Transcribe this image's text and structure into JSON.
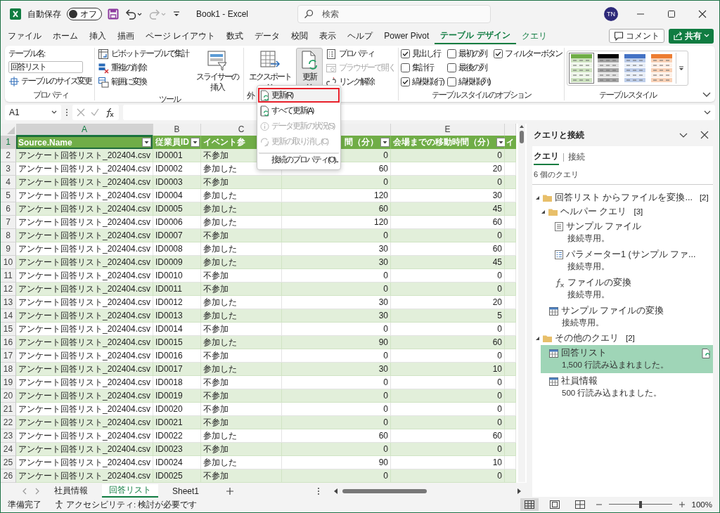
{
  "window": {
    "title": "Book1 - Excel",
    "autosave": {
      "label": "自動保存",
      "state_text": "オフ",
      "on": false
    },
    "quick_access": [
      {
        "kind": "save",
        "disabled": false
      },
      {
        "kind": "undo",
        "disabled": false
      },
      {
        "kind": "redo",
        "disabled": true
      },
      {
        "kind": "customize",
        "disabled": false
      }
    ],
    "search": {
      "placeholder": "検索"
    },
    "avatar": "TN"
  },
  "menu_tabs": [
    {
      "label": "ファイル",
      "selected": false,
      "contextual": false
    },
    {
      "label": "ホーム",
      "selected": false,
      "contextual": false
    },
    {
      "label": "挿入",
      "selected": false,
      "contextual": false
    },
    {
      "label": "描画",
      "selected": false,
      "contextual": false
    },
    {
      "label": "ページ レイアウト",
      "selected": false,
      "contextual": false
    },
    {
      "label": "数式",
      "selected": false,
      "contextual": false
    },
    {
      "label": "データ",
      "selected": false,
      "contextual": false
    },
    {
      "label": "校閲",
      "selected": false,
      "contextual": false
    },
    {
      "label": "表示",
      "selected": false,
      "contextual": false
    },
    {
      "label": "ヘルプ",
      "selected": false,
      "contextual": false
    },
    {
      "label": "Power Pivot",
      "selected": false,
      "contextual": false
    },
    {
      "label": "テーブル デザイン",
      "selected": true,
      "contextual": true
    },
    {
      "label": "クエリ",
      "selected": false,
      "contextual": true
    }
  ],
  "comment_button": "コメント",
  "share_button": "共有",
  "ribbon": {
    "properties": {
      "table_name_label": "テーブル名:",
      "table_name_value": "回答リスト",
      "resize_button": "テーブルのサイズ変更",
      "group_label": "プロパティ"
    },
    "tools": {
      "buttons": [
        {
          "kind": "pivot",
          "label": "ピボットテーブルで集計"
        },
        {
          "kind": "dedupe",
          "label": "重複の削除"
        },
        {
          "kind": "convert",
          "label": "範囲に変換"
        }
      ],
      "slicer_button": [
        "スライサーの",
        "挿入"
      ],
      "group_label": "ツール"
    },
    "external": {
      "export_button": "エクスポート",
      "refresh_button": {
        "label": "更新",
        "pressed": true
      },
      "small_buttons": [
        {
          "kind": "properties",
          "label": "プロパティ",
          "disabled": false
        },
        {
          "kind": "browser",
          "label": "ブラウザーで開く",
          "disabled": true
        },
        {
          "kind": "unlink",
          "label": "リンク解除",
          "disabled": false
        }
      ],
      "group_label": "外"
    },
    "style_options": {
      "checkboxes": [
        {
          "label": "見出し行",
          "checked": true
        },
        {
          "label": "集計行",
          "checked": false
        },
        {
          "label": "縞模様 (行)",
          "checked": true
        },
        {
          "label": "最初の列",
          "checked": false
        },
        {
          "label": "最後の列",
          "checked": false
        },
        {
          "label": "縞模様 (列)",
          "checked": false
        },
        {
          "label": "フィルター ボタン",
          "checked": true
        }
      ],
      "group_label": "テーブル スタイルのオプション"
    },
    "table_styles": {
      "swatches": [
        {
          "color": "#70ad47",
          "selected": true
        },
        {
          "color": "#000000",
          "selected": false
        },
        {
          "color": "#4472c4",
          "selected": false
        },
        {
          "color": "#ed7d31",
          "selected": false
        }
      ],
      "group_label": "テーブル スタイル"
    }
  },
  "refresh_menu": {
    "items": [
      {
        "kind": "refresh",
        "label": "更新(R)",
        "disabled": false,
        "highlighted": true,
        "separator_before": false
      },
      {
        "kind": "refresh_all",
        "label": "すべて更新(A)",
        "disabled": false,
        "highlighted": false,
        "separator_before": false
      },
      {
        "kind": "status",
        "label": "データ更新の状況(S)",
        "disabled": true,
        "highlighted": false,
        "separator_before": false
      },
      {
        "kind": "cancel",
        "label": "更新の取り消し(C)",
        "disabled": true,
        "highlighted": false,
        "separator_before": false
      },
      {
        "kind": "properties",
        "label": "接続のプロパティ(O)...",
        "disabled": false,
        "highlighted": false,
        "separator_before": true
      }
    ]
  },
  "formula_bar": {
    "name_box": "A1"
  },
  "sheet": {
    "columns": [
      {
        "letter": "A",
        "header": "Source.Name",
        "filter": true,
        "kind": "text",
        "selected": true
      },
      {
        "letter": "B",
        "header": "従業員ID",
        "filter": true,
        "kind": "text",
        "selected": false
      },
      {
        "letter": "C",
        "header": "イベント参",
        "kind": "text",
        "selected": false
      },
      {
        "header": "間（分）",
        "filter": true,
        "kind": "number",
        "selected": false
      },
      {
        "letter": "E",
        "header": "会場までの移動時間（分）",
        "filter": true,
        "kind": "number",
        "selected": false
      },
      {
        "header": "イ",
        "filter": false,
        "kind": "text",
        "selected": false
      }
    ],
    "row_numbers": [
      "1",
      "2",
      "3",
      "4",
      "5",
      "6",
      "7",
      "8",
      "9",
      "10",
      "11",
      "12",
      "13",
      "14",
      "15",
      "16",
      "17",
      "18",
      "19",
      "20",
      "21",
      "22",
      "23",
      "24",
      "25",
      "26"
    ],
    "rows": [
      [
        "アンケート回答リスト_202404.csv",
        "ID0001",
        "不参加",
        "0",
        "0"
      ],
      [
        "アンケート回答リスト_202404.csv",
        "ID0002",
        "参加した",
        "60",
        "20"
      ],
      [
        "アンケート回答リスト_202404.csv",
        "ID0003",
        "不参加",
        "0",
        "0"
      ],
      [
        "アンケート回答リスト_202404.csv",
        "ID0004",
        "参加した",
        "120",
        "30"
      ],
      [
        "アンケート回答リスト_202404.csv",
        "ID0005",
        "参加した",
        "60",
        "45"
      ],
      [
        "アンケート回答リスト_202404.csv",
        "ID0006",
        "参加した",
        "120",
        "60"
      ],
      [
        "アンケート回答リスト_202404.csv",
        "ID0007",
        "不参加",
        "0",
        "0"
      ],
      [
        "アンケート回答リスト_202404.csv",
        "ID0008",
        "参加した",
        "30",
        "60"
      ],
      [
        "アンケート回答リスト_202404.csv",
        "ID0009",
        "参加した",
        "30",
        "45"
      ],
      [
        "アンケート回答リスト_202404.csv",
        "ID0010",
        "不参加",
        "0",
        "0"
      ],
      [
        "アンケート回答リスト_202404.csv",
        "ID0011",
        "不参加",
        "0",
        "0"
      ],
      [
        "アンケート回答リスト_202404.csv",
        "ID0012",
        "参加した",
        "30",
        "20"
      ],
      [
        "アンケート回答リスト_202404.csv",
        "ID0013",
        "参加した",
        "30",
        "5"
      ],
      [
        "アンケート回答リスト_202404.csv",
        "ID0014",
        "不参加",
        "0",
        "0"
      ],
      [
        "アンケート回答リスト_202404.csv",
        "ID0015",
        "参加した",
        "90",
        "60"
      ],
      [
        "アンケート回答リスト_202404.csv",
        "ID0016",
        "不参加",
        "0",
        "0"
      ],
      [
        "アンケート回答リスト_202404.csv",
        "ID0017",
        "参加した",
        "30",
        "10"
      ],
      [
        "アンケート回答リスト_202404.csv",
        "ID0018",
        "不参加",
        "0",
        "0"
      ],
      [
        "アンケート回答リスト_202404.csv",
        "ID0019",
        "不参加",
        "0",
        "0"
      ],
      [
        "アンケート回答リスト_202404.csv",
        "ID0020",
        "不参加",
        "0",
        "0"
      ],
      [
        "アンケート回答リスト_202404.csv",
        "ID0021",
        "不参加",
        "0",
        "0"
      ],
      [
        "アンケート回答リスト_202404.csv",
        "ID0022",
        "参加した",
        "60",
        "60"
      ],
      [
        "アンケート回答リスト_202404.csv",
        "ID0023",
        "不参加",
        "0",
        "0"
      ],
      [
        "アンケート回答リスト_202404.csv",
        "ID0024",
        "参加した",
        "90",
        "10"
      ],
      [
        "アンケート回答リスト_202404.csv",
        "ID0025",
        "不参加",
        "0",
        "0"
      ]
    ]
  },
  "sheet_tabs": [
    {
      "label": "社員情報",
      "selected": false
    },
    {
      "label": "回答リスト",
      "selected": true
    },
    {
      "label": "Sheet1",
      "selected": false
    }
  ],
  "queries_pane": {
    "title": "クエリと接続",
    "tabs": [
      {
        "label": "クエリ",
        "selected": true
      },
      {
        "label": "接続",
        "selected": false
      }
    ],
    "count": "6 個のクエリ",
    "tree": [
      {
        "kind": "folder",
        "label": "回答リスト からファイルを変換...",
        "count": "[2]",
        "expanded": true,
        "children": [
          {
            "kind": "folder",
            "label": "ヘルパー クエリ",
            "count": "[3]",
            "expanded": true,
            "children": [
              {
                "kind": "document_query",
                "label": "サンプル ファイル",
                "status": "接続専用。",
                "selected": false
              },
              {
                "kind": "parameter_query",
                "label": "パラメーター1 (サンプル ファ...",
                "status": "接続専用。",
                "selected": false
              },
              {
                "kind": "function_query",
                "label": "ファイルの変換",
                "status": "接続専用。",
                "selected": false
              }
            ]
          },
          {
            "kind": "table_query",
            "label": "サンプル ファイルの変換",
            "status": "接続専用。",
            "selected": false
          }
        ]
      },
      {
        "kind": "folder",
        "label": "その他のクエリ",
        "count": "[2]",
        "expanded": true,
        "children": [
          {
            "kind": "table_query",
            "label": "回答リスト",
            "status": "1,500 行読み込まれました。",
            "selected": true
          },
          {
            "kind": "table_query",
            "label": "社員情報",
            "status": "500 行読み込まれました。",
            "selected": false
          }
        ]
      }
    ]
  },
  "status_bar": {
    "ready": "準備完了",
    "accessibility": "アクセシビリティ: 検討が必要です",
    "views": [
      {
        "kind": "normal",
        "selected": true
      },
      {
        "kind": "page_layout",
        "selected": false
      },
      {
        "kind": "page_break",
        "selected": false
      }
    ],
    "zoom": {
      "level": 0.5,
      "reading": "100%"
    }
  }
}
